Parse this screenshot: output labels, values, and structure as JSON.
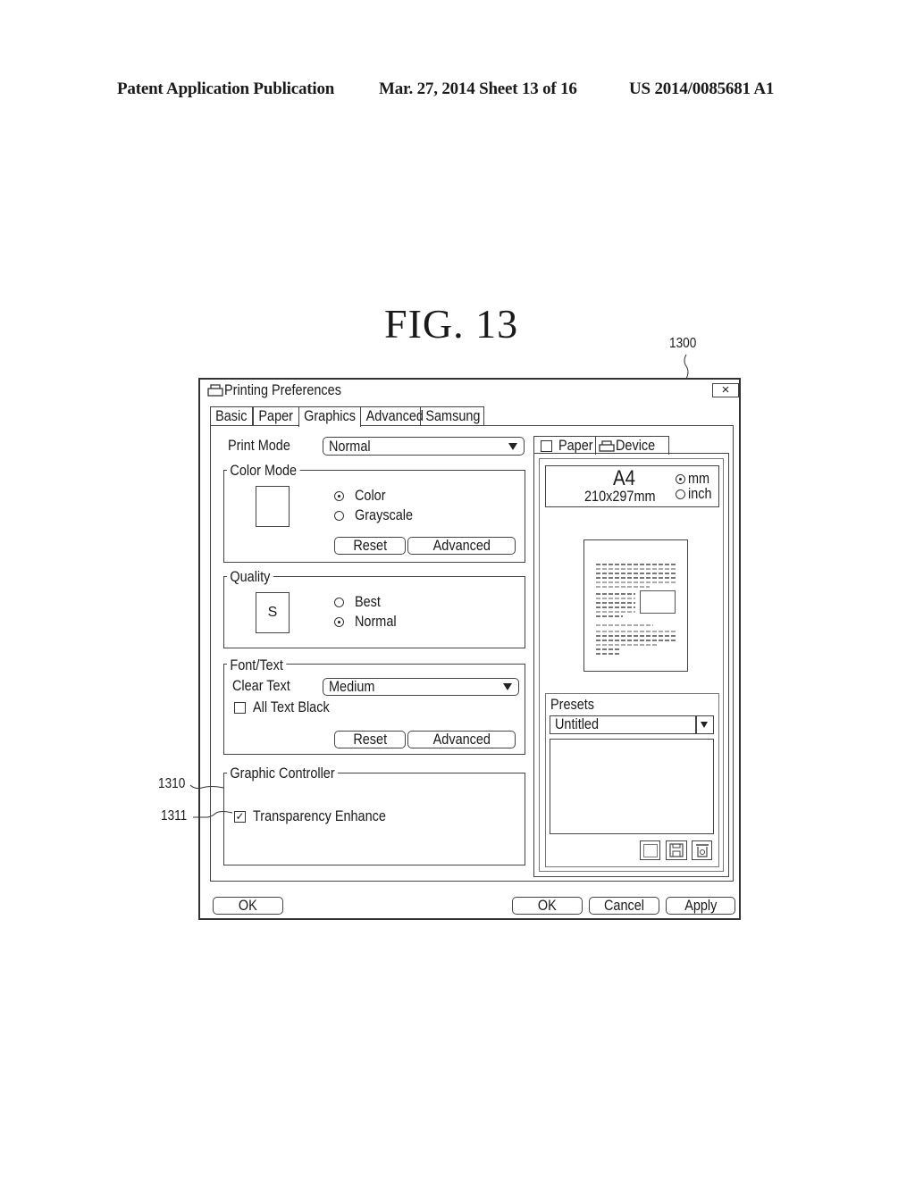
{
  "header": {
    "left": "Patent Application Publication",
    "middle": "Mar. 27, 2014  Sheet 13 of 16",
    "right": "US 2014/0085681 A1"
  },
  "figure": {
    "title": "FIG.  13",
    "ref_window": "1300",
    "ref_group": "1310",
    "ref_checkbox": "1311"
  },
  "window": {
    "title": "Printing Preferences",
    "close_label": "×",
    "tabs": [
      {
        "label": "Basic",
        "active": false
      },
      {
        "label": "Paper",
        "active": false
      },
      {
        "label": "Graphics",
        "active": true
      },
      {
        "label": "Advanced",
        "active": false
      },
      {
        "label": "Samsung",
        "active": false
      }
    ],
    "print_mode": {
      "label": "Print Mode",
      "value": "Normal"
    },
    "color_mode": {
      "legend": "Color Mode",
      "options": [
        {
          "label": "Color",
          "selected": true
        },
        {
          "label": "Grayscale",
          "selected": false
        }
      ],
      "reset_label": "Reset",
      "advanced_label": "Advanced"
    },
    "quality": {
      "legend": "Quality",
      "preview_letter": "S",
      "options": [
        {
          "label": "Best",
          "selected": false
        },
        {
          "label": "Normal",
          "selected": true
        }
      ]
    },
    "font_text": {
      "legend": "Font/Text",
      "clear_text_label": "Clear Text",
      "clear_text_value": "Medium",
      "all_text_black_label": "All Text Black",
      "all_text_black_checked": false,
      "reset_label": "Reset",
      "advanced_label": "Advanced"
    },
    "graphic_controller": {
      "legend": "Graphic Controller",
      "transparency_label": "Transparency Enhance",
      "transparency_checked": true,
      "check_glyph": "✓"
    },
    "side_panel": {
      "tabs": [
        {
          "label": "Paper"
        },
        {
          "label": "Device"
        }
      ],
      "paper_size": "A4",
      "paper_dims": "210x297mm",
      "units": [
        {
          "label": "mm",
          "selected": true
        },
        {
          "label": "inch",
          "selected": false
        }
      ],
      "presets_label": "Presets",
      "preset_value": "Untitled"
    },
    "buttons": {
      "ok_left": "OK",
      "ok": "OK",
      "cancel": "Cancel",
      "apply": "Apply"
    }
  }
}
